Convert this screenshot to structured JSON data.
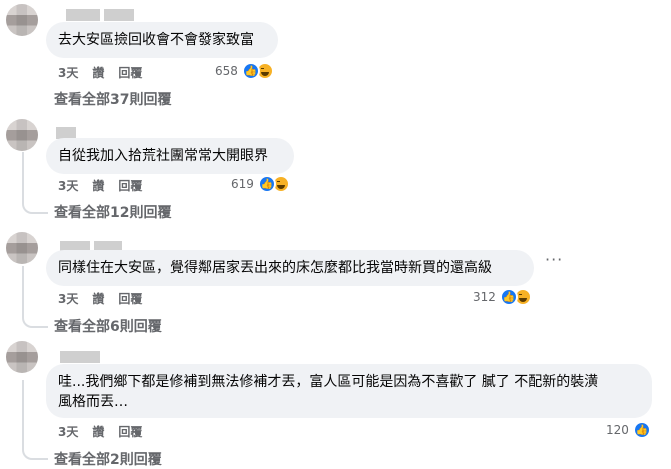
{
  "comments": [
    {
      "text": "去大安區撿回收會不會發家致富",
      "time": "3天",
      "like_label": "讚",
      "reply_label": "回覆",
      "reaction_count": "658",
      "view_replies": "查看全部37則回覆"
    },
    {
      "text": "自從我加入拾荒社團常常大開眼界",
      "time": "3天",
      "like_label": "讚",
      "reply_label": "回覆",
      "reaction_count": "619",
      "view_replies": "查看全部12則回覆"
    },
    {
      "text": "同樣住在大安區，覺得鄰居家丟出來的床怎麼都比我當時新買的還高級",
      "time": "3天",
      "like_label": "讚",
      "reply_label": "回覆",
      "reaction_count": "312",
      "view_replies": "查看全部6則回覆",
      "more_label": "···"
    },
    {
      "text_line1": "哇...我們鄉下都是修補到無法修補才丟，富人區可能是因為不喜歡了 膩了 不配新的裝潢",
      "text_line2": "風格而丟…",
      "time": "3天",
      "like_label": "讚",
      "reply_label": "回覆",
      "reaction_count": "120",
      "view_replies": "查看全部2則回覆"
    }
  ],
  "icons": {
    "like": "like-reaction-icon",
    "haha": "haha-reaction-icon"
  },
  "colors": {
    "bubble": "#f0f2f5",
    "meta": "#65676b",
    "like": "#1877f2",
    "haha": "#f7b125"
  }
}
